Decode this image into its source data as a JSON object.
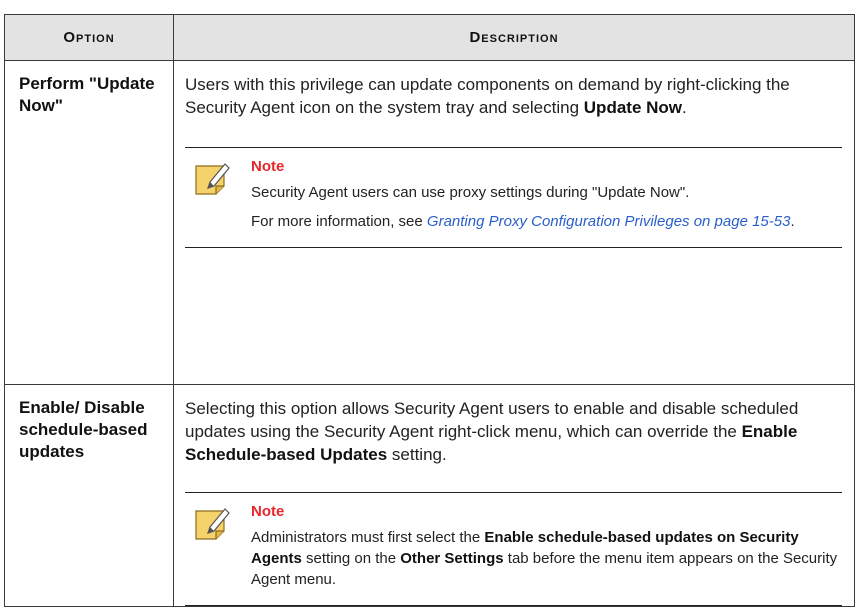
{
  "table": {
    "headers": {
      "option": "Option",
      "description": "Description"
    },
    "rows": [
      {
        "option": "Perform \"Update Now\"",
        "desc_part1": "Users with this privilege can update components on demand by right-clicking the Security Agent icon on the system tray and selecting ",
        "desc_bold1": "Update Now",
        "desc_part2": ".",
        "note": {
          "title": "Note",
          "line1": "Security Agent users can use proxy settings during \"Update Now\".",
          "line2_prefix": "For more information, see ",
          "line2_link": "Granting Proxy Configuration Privileges on page 15-53",
          "line2_suffix": "."
        }
      },
      {
        "option": "Enable/ Disable schedule-based updates",
        "desc_part1": "Selecting this option allows Security Agent users to enable and disable scheduled updates using the Security Agent right-click menu, which can override the ",
        "desc_bold1": "Enable Schedule-based Updates",
        "desc_part2": " setting.",
        "note": {
          "title": "Note",
          "t1": "Administrators must first select the ",
          "b1": "Enable schedule-based updates on Security Agents",
          "t2": " setting on the ",
          "b2": "Other Settings",
          "t3": " tab before the menu item appears on the Security Agent menu."
        }
      }
    ]
  },
  "icons": {
    "note_icon": "note-pencil-icon",
    "note_color": "#f5d26a"
  }
}
